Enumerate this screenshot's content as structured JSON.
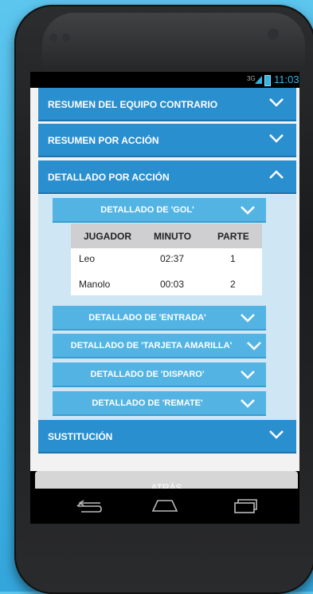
{
  "status_bar": {
    "network": "3G",
    "time": "11:03"
  },
  "sections": {
    "equipo_contrario": "RESUMEN DEL EQUIPO CONTRARIO",
    "por_accion": "RESUMEN POR ACCIÓN",
    "detallado": "DETALLADO POR ACCIÓN",
    "sustitucion": "SUSTITUCIÓN"
  },
  "subsections": {
    "gol": "DETALLADO DE 'GOL'",
    "entrada": "DETALLADO DE 'ENTRADA'",
    "tarjeta": "DETALLADO DE 'TARJETA AMARILLA'",
    "disparo": "DETALLADO DE 'DISPARO'",
    "remate": "DETALLADO DE 'REMATE'"
  },
  "table": {
    "headers": [
      "JUGADOR",
      "MINUTO",
      "PARTE"
    ],
    "rows": [
      [
        "Leo",
        "02:37",
        "1"
      ],
      [
        "Manolo",
        "00:03",
        "2"
      ]
    ]
  },
  "back_button": "ATRÁS",
  "colors": {
    "accent": "#2a8fcf",
    "sub_accent": "#53b4e3",
    "status": "#33b5e5"
  }
}
